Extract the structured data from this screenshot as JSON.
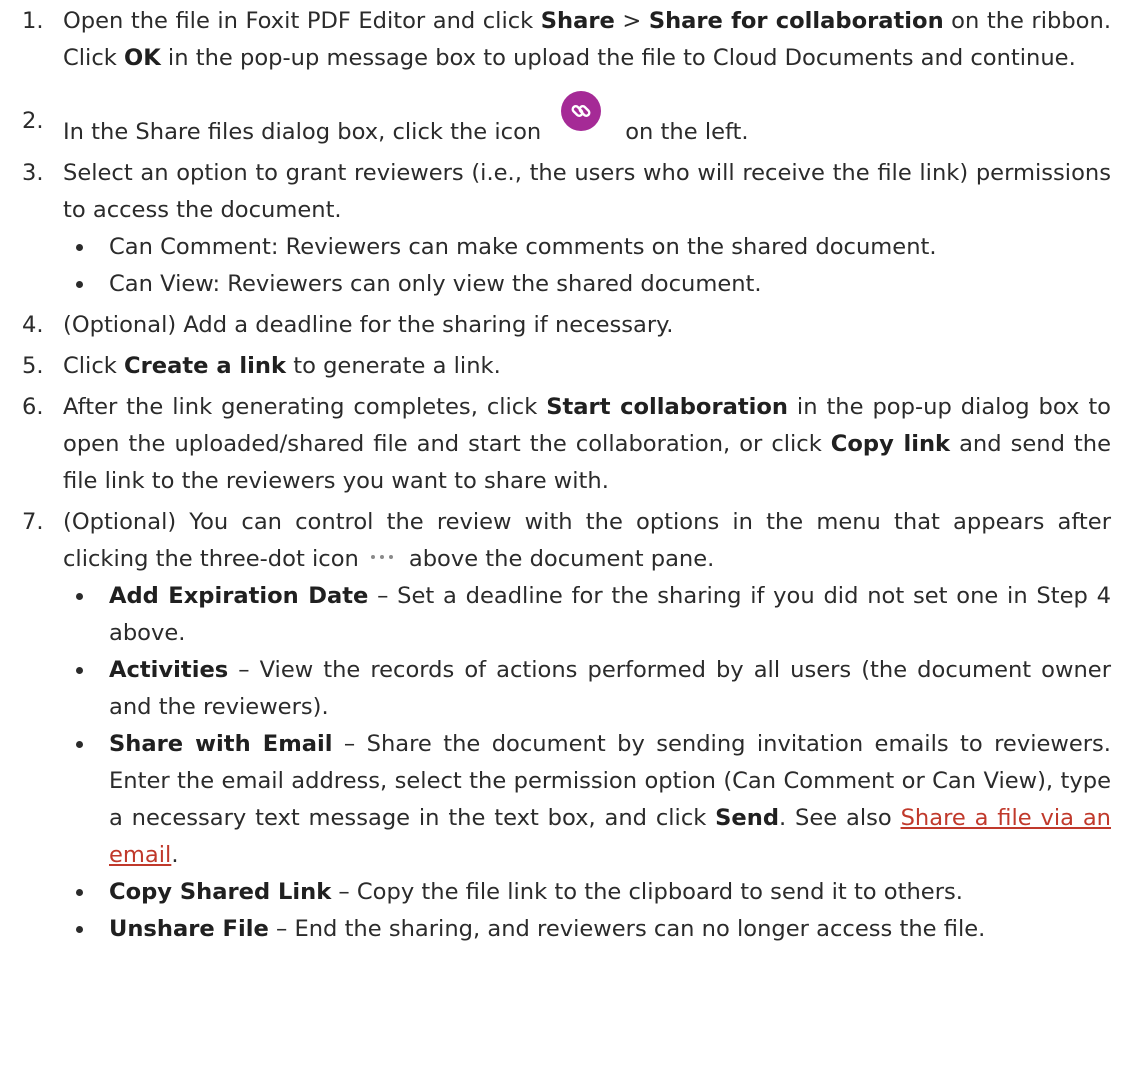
{
  "steps": [
    {
      "n": "1.",
      "a": "Open the file in Foxit PDF Editor and click ",
      "b1": "Share",
      "c": " > ",
      "b2": "Share for collaboration",
      "d": " on the ribbon. Click ",
      "b3": "OK",
      "e": " in the pop-up message box to upload the file to Cloud Documents and continue."
    },
    {
      "n": "2.",
      "a": "In the Share files dialog box, click the icon",
      "icon": "link-icon",
      "b": "on the left."
    },
    {
      "n": "3.",
      "a": "Select an option to grant reviewers (i.e., the users who will receive the file link) permissions to access the document.",
      "bullets": [
        "Can Comment: Reviewers can make comments on the shared document.",
        "Can View: Reviewers can only view the shared document."
      ]
    },
    {
      "n": "4.",
      "a": "(Optional) Add a deadline for the sharing if necessary."
    },
    {
      "n": "5.",
      "a": "Click ",
      "b1": "Create a link",
      "c": " to generate a link."
    },
    {
      "n": "6.",
      "a": "After the link generating completes, click ",
      "b1": "Start collaboration",
      "c": " in the pop-up dialog box to open the uploaded/shared file and start the collaboration, or click ",
      "b2": "Copy link",
      "d": " and send the file link to the reviewers you want to share with."
    },
    {
      "n": "7.",
      "a": "(Optional) You can control the review with the options in the menu that appears after clicking the three-dot icon",
      "icon": "three-dot-icon",
      "b": "above the document pane.",
      "bullets": [
        {
          "term": "Add Expiration Date",
          "text": " – Set a deadline for the sharing if you did not set one in Step 4 above."
        },
        {
          "term": "Activities",
          "text": " – View the records of actions performed by all users (the document owner and the reviewers)."
        },
        {
          "term": "Share with Email",
          "text": " – Share the document by sending invitation emails to reviewers. Enter the email address, select the permission option (Can Comment or Can View), type a necessary text message in the text box, and click ",
          "bold2": "Send",
          "text2": ". See also ",
          "link": "Share a file via an email",
          "text3": "."
        },
        {
          "term": "Copy Shared Link",
          "text": " – Copy the file link to the clipboard to send it to others."
        },
        {
          "term": "Unshare File",
          "text": " – End the sharing, and reviewers can no longer access the file."
        }
      ]
    }
  ],
  "colors": {
    "icon_bg": "#a52a96",
    "link": "#c0392b"
  }
}
